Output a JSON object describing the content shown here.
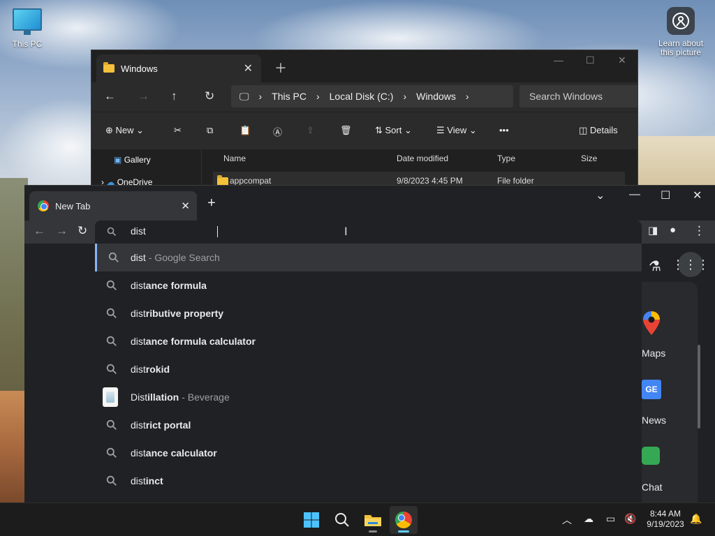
{
  "desktop": {
    "icons": [
      {
        "label": "This PC"
      },
      {
        "label": "Learn about this picture"
      }
    ]
  },
  "explorer": {
    "tab_title": "Windows",
    "breadcrumb": [
      "This PC",
      "Local Disk (C:)",
      "Windows"
    ],
    "search_placeholder": "Search Windows",
    "toolbar": {
      "new": "New",
      "sort": "Sort",
      "view": "View",
      "details": "Details"
    },
    "sidebar": [
      "Gallery",
      "OneDrive"
    ],
    "columns": [
      "Name",
      "Date modified",
      "Type",
      "Size"
    ],
    "rows": [
      {
        "name": "appcompat",
        "date": "9/8/2023 4:45 PM",
        "type": "File folder"
      }
    ]
  },
  "chrome": {
    "tab_title": "New Tab",
    "omnibox_value": "dist",
    "suggestions": [
      {
        "typed": "dist",
        "rest": "",
        "suffix": "- Google Search",
        "kind": "search",
        "selected": true
      },
      {
        "typed": "dist",
        "rest": "ance formula",
        "suffix": "",
        "kind": "search"
      },
      {
        "typed": "dist",
        "rest": "ributive property",
        "suffix": "",
        "kind": "search"
      },
      {
        "typed": "dist",
        "rest": "ance formula calculator",
        "suffix": "",
        "kind": "search"
      },
      {
        "typed": "dist",
        "rest": "rokid",
        "suffix": "",
        "kind": "search"
      },
      {
        "typed": "Dist",
        "rest": "illation",
        "suffix": "- Beverage",
        "kind": "entity"
      },
      {
        "typed": "dist",
        "rest": "rict portal",
        "suffix": "",
        "kind": "search"
      },
      {
        "typed": "dist",
        "rest": "ance calculator",
        "suffix": "",
        "kind": "search"
      },
      {
        "typed": "dist",
        "rest": "inct",
        "suffix": "",
        "kind": "search"
      }
    ],
    "shortcuts": [
      "Maps",
      "News",
      "Chat"
    ]
  },
  "taskbar": {
    "time": "8:44 AM",
    "date": "9/19/2023"
  }
}
